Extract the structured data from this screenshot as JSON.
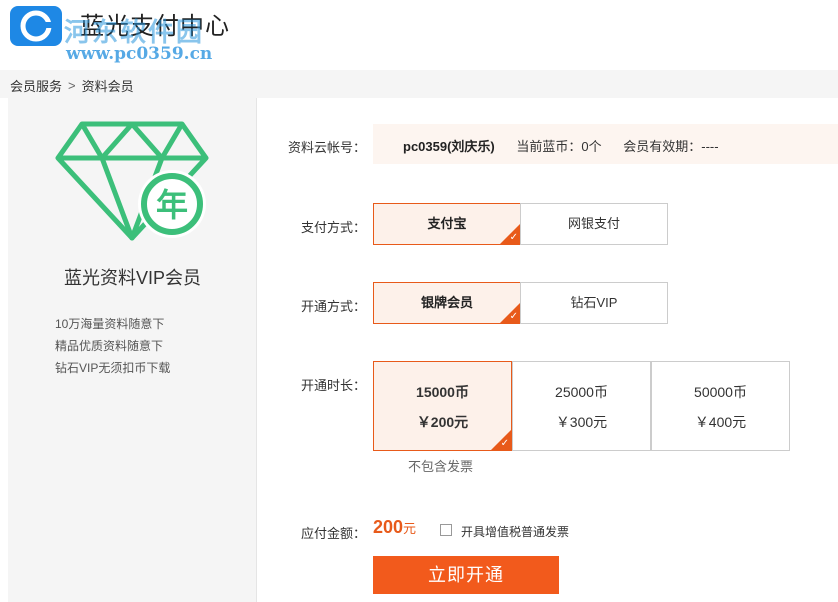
{
  "header": {
    "title": "蓝光支付中心",
    "watermark_text": "河东软件园",
    "watermark_url": "www.pc0359.cn"
  },
  "breadcrumb": {
    "parent": "会员服务",
    "separator": ">",
    "current": "资料会员"
  },
  "left": {
    "badge_char": "年",
    "vip_title": "蓝光资料VIP会员",
    "features": [
      "10万海量资料随意下",
      "精品优质资料随意下",
      "钻石VIP无须扣币下载"
    ]
  },
  "account": {
    "label": "资料云帐号：",
    "name": "pc0359(刘庆乐)",
    "coins": "当前蓝币：0个",
    "validity": "会员有效期：----"
  },
  "payment": {
    "label": "支付方式：",
    "options": [
      "支付宝",
      "网银支付"
    ],
    "selected": 0
  },
  "membership": {
    "label": "开通方式：",
    "options": [
      "银牌会员",
      "钻石VIP"
    ],
    "selected": 0
  },
  "duration": {
    "label": "开通时长：",
    "options": [
      {
        "coins": "15000币",
        "price": "￥200元"
      },
      {
        "coins": "25000币",
        "price": "￥300元"
      },
      {
        "coins": "50000币",
        "price": "￥400元"
      }
    ],
    "selected": 0,
    "note": "不包含发票"
  },
  "total": {
    "label": "应付金额：",
    "amount": "200",
    "unit": "元",
    "vat_label": "开具增值税普通发票",
    "vat_checked": false
  },
  "submit_label": "立即开通",
  "colors": {
    "accent": "#e85a1a",
    "button": "#f25a1c",
    "diamond": "#3cbf7a"
  },
  "icons": {
    "logo": "lg-logo-icon",
    "diamond": "diamond-icon",
    "check": "check-corner-icon"
  }
}
